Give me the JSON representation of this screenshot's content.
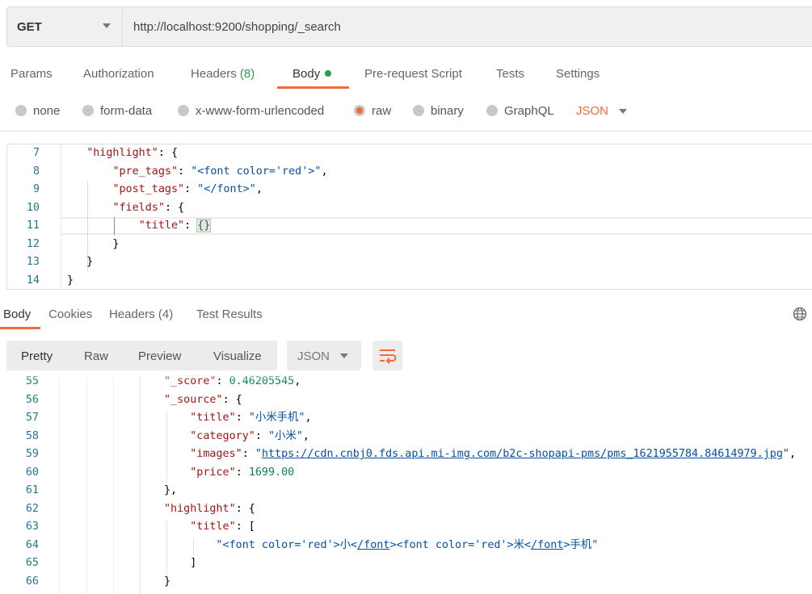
{
  "request": {
    "method": "GET",
    "url": "http://localhost:9200/shopping/_search"
  },
  "request_tabs": [
    {
      "label": "Params"
    },
    {
      "label": "Authorization"
    },
    {
      "label": "Headers",
      "count": "(8)"
    },
    {
      "label": "Body",
      "active": true
    },
    {
      "label": "Pre-request Script"
    },
    {
      "label": "Tests"
    },
    {
      "label": "Settings"
    }
  ],
  "body_types": [
    {
      "label": "none"
    },
    {
      "label": "form-data"
    },
    {
      "label": "x-www-form-urlencoded"
    },
    {
      "label": "raw",
      "selected": true
    },
    {
      "label": "binary"
    },
    {
      "label": "GraphQL"
    }
  ],
  "body_format": "JSON",
  "request_code": [
    {
      "n": "7",
      "t": [
        [
          "p",
          "   "
        ],
        [
          "k",
          "\"highlight\""
        ],
        [
          "p",
          ": {"
        ]
      ]
    },
    {
      "n": "8",
      "t": [
        [
          "p",
          "       "
        ],
        [
          "k",
          "\"pre_tags\""
        ],
        [
          "p",
          ": "
        ],
        [
          "s",
          "\"<font color='red'>\""
        ],
        [
          "p",
          ","
        ]
      ]
    },
    {
      "n": "9",
      "t": [
        [
          "p",
          "       "
        ],
        [
          "k",
          "\"post_tags\""
        ],
        [
          "p",
          ": "
        ],
        [
          "s",
          "\"</font>\""
        ],
        [
          "p",
          ","
        ]
      ]
    },
    {
      "n": "10",
      "t": [
        [
          "p",
          "       "
        ],
        [
          "k",
          "\"fields\""
        ],
        [
          "p",
          ": {"
        ]
      ]
    },
    {
      "n": "11",
      "t": [
        [
          "p",
          "           "
        ],
        [
          "k",
          "\"title\""
        ],
        [
          "p",
          ": "
        ],
        [
          "br",
          "{}"
        ]
      ]
    },
    {
      "n": "12",
      "t": [
        [
          "p",
          "       }"
        ]
      ]
    },
    {
      "n": "13",
      "t": [
        [
          "p",
          "   }"
        ]
      ]
    },
    {
      "n": "14",
      "t": [
        [
          "p",
          "}"
        ]
      ]
    }
  ],
  "response_tabs": [
    {
      "label": "Body",
      "active": true
    },
    {
      "label": "Cookies"
    },
    {
      "label": "Headers",
      "count": "(4)"
    },
    {
      "label": "Test Results"
    }
  ],
  "response_views": [
    "Pretty",
    "Raw",
    "Preview",
    "Visualize"
  ],
  "response_format": "JSON",
  "response_code": [
    {
      "n": "55",
      "t": [
        [
          "p",
          "                "
        ],
        [
          "k",
          "\"_score\""
        ],
        [
          "p",
          ": "
        ],
        [
          "n",
          "0.46205545"
        ],
        [
          "p",
          ","
        ]
      ]
    },
    {
      "n": "56",
      "t": [
        [
          "p",
          "                "
        ],
        [
          "k",
          "\"_source\""
        ],
        [
          "p",
          ": {"
        ]
      ]
    },
    {
      "n": "57",
      "t": [
        [
          "p",
          "                    "
        ],
        [
          "k",
          "\"title\""
        ],
        [
          "p",
          ": "
        ],
        [
          "s",
          "\"小米手机\""
        ],
        [
          "p",
          ","
        ]
      ]
    },
    {
      "n": "58",
      "t": [
        [
          "p",
          "                    "
        ],
        [
          "k",
          "\"category\""
        ],
        [
          "p",
          ": "
        ],
        [
          "s",
          "\"小米\""
        ],
        [
          "p",
          ","
        ]
      ]
    },
    {
      "n": "59",
      "t": [
        [
          "p",
          "                    "
        ],
        [
          "k",
          "\"images\""
        ],
        [
          "p",
          ": "
        ],
        [
          "s",
          "\""
        ],
        [
          "lk",
          "https://cdn.cnbj0.fds.api.mi-img.com/b2c-shopapi-pms/pms_1621955784.84614979.jpg"
        ],
        [
          "s",
          "\""
        ],
        [
          "p",
          ","
        ]
      ]
    },
    {
      "n": "60",
      "t": [
        [
          "p",
          "                    "
        ],
        [
          "k",
          "\"price\""
        ],
        [
          "p",
          ": "
        ],
        [
          "n",
          "1699.00"
        ]
      ]
    },
    {
      "n": "61",
      "t": [
        [
          "p",
          "                },"
        ]
      ]
    },
    {
      "n": "62",
      "t": [
        [
          "p",
          "                "
        ],
        [
          "k",
          "\"highlight\""
        ],
        [
          "p",
          ": {"
        ]
      ]
    },
    {
      "n": "63",
      "t": [
        [
          "p",
          "                    "
        ],
        [
          "k",
          "\"title\""
        ],
        [
          "p",
          ": ["
        ]
      ]
    },
    {
      "n": "64",
      "t": [
        [
          "p",
          "                        "
        ],
        [
          "s",
          "\"<font color='red'>小<"
        ],
        [
          "lk",
          "/font"
        ],
        [
          "s",
          ">"
        ],
        [
          "s",
          "<font color='red'>米<"
        ],
        [
          "lk",
          "/font"
        ],
        [
          "s",
          ">手机\""
        ]
      ]
    },
    {
      "n": "65",
      "t": [
        [
          "p",
          "                    ]"
        ]
      ]
    },
    {
      "n": "66",
      "t": [
        [
          "p",
          "                }"
        ]
      ]
    }
  ],
  "colors": {
    "accent": "#f26b3a",
    "count_green": "#2d9c48",
    "key": "#a31515",
    "string": "#0451a5",
    "number": "#098658",
    "line_number": "#237893"
  }
}
